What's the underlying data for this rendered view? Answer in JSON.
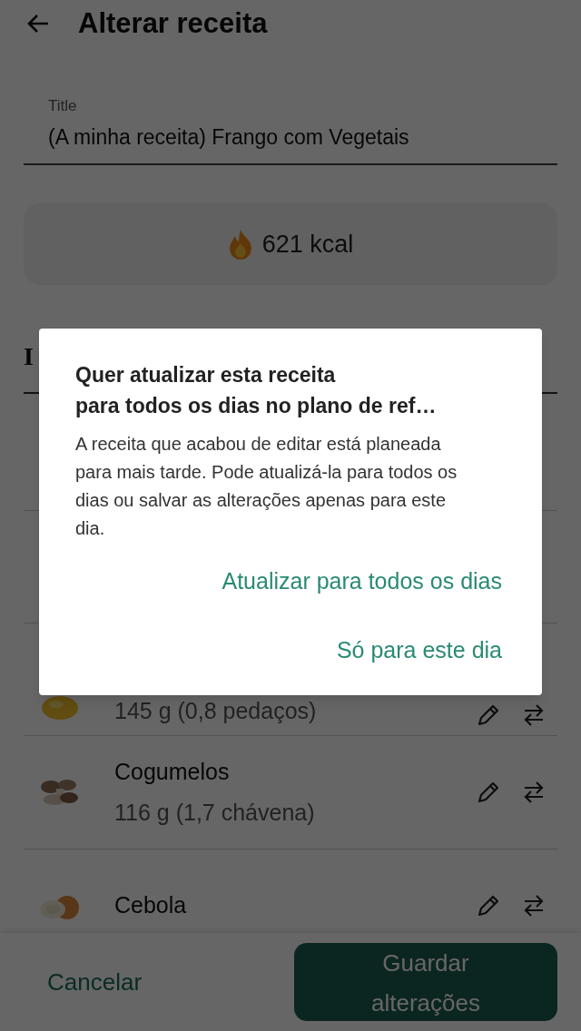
{
  "header": {
    "title": "Alterar receita"
  },
  "title_field": {
    "label": "Title",
    "value": "(A minha receita) Frango com Vegetais"
  },
  "calories": "621 kcal",
  "section_heading": "I",
  "ingredients": [
    {
      "kind": "partial",
      "amount": "145 g (0,8 pedaços)"
    },
    {
      "kind": "full",
      "name": "Cogumelos",
      "amount": "116 g (1,7 chávena)"
    },
    {
      "kind": "name_only",
      "name": "Cebola"
    }
  ],
  "footer": {
    "cancel": "Cancelar",
    "save": "Guardar alterações"
  },
  "dialog": {
    "title": "Quer atualizar esta receita\npara todos os dias no plano de ref…",
    "body": "A receita que acabou de editar está planeada para mais tarde. Pode atualizá-la para todos os dias ou salvar as alterações apenas para este dia.",
    "actions": [
      "Atualizar para todos os dias",
      "Só para este dia"
    ]
  }
}
